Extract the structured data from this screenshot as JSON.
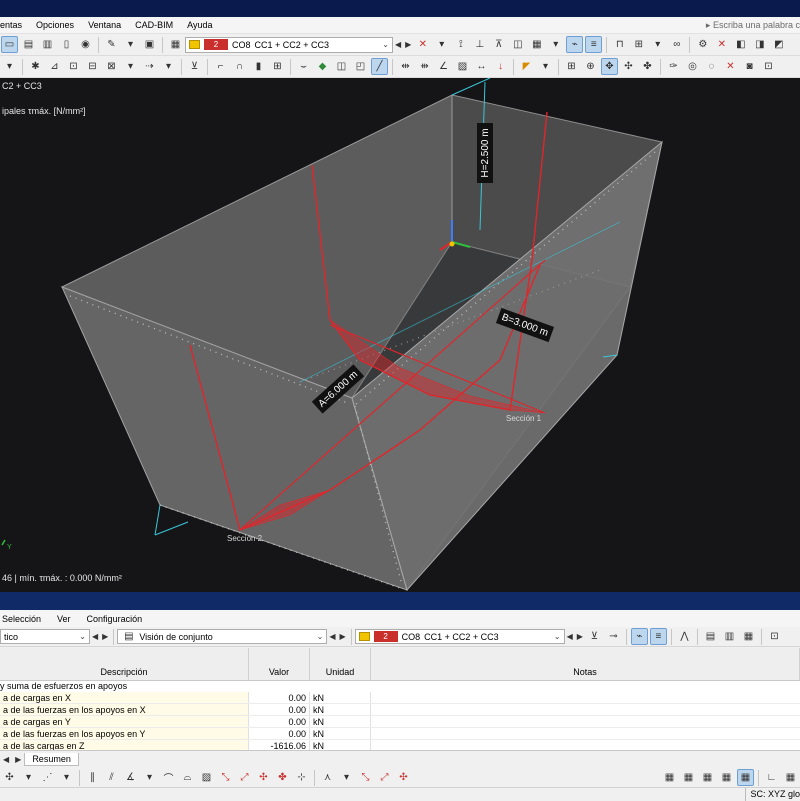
{
  "menu": [
    "entas",
    "Opciones",
    "Ventana",
    "CAD-BIM",
    "Ayuda"
  ],
  "search": {
    "placeholder": "Escriba una palabra c"
  },
  "toolbar": {
    "lc_number": "2",
    "lc_name": "CO8",
    "lc_description": "CC1 + CC2 + CC3",
    "swatch_color": "#f2c400",
    "number_color": "#c9302c"
  },
  "viewport": {
    "top_label": "C2 + CC3",
    "result_label": "ipales τmáx. [N/mm²]",
    "bottom_label": "46 | mín. τmáx. : 0.000 N/mm²",
    "dimensions": {
      "h": "H=2.500 m",
      "b": "B=3.000 m",
      "a": "A=6.000 m"
    },
    "sections": [
      "Sección 1",
      "Sección 2"
    ],
    "axis_label": "Y"
  },
  "panel": {
    "menu": [
      "Selección",
      "Ver",
      "Configuración"
    ],
    "filter_combo": "tico",
    "view_combo": "Visión de conjunto",
    "lc_number": "2",
    "lc_name": "CO8",
    "lc_description": "CC1 + CC2 + CC3"
  },
  "table": {
    "headers": {
      "description": "Descripción",
      "value": "Valor",
      "unit": "Unidad",
      "notes": "Notas"
    },
    "section_title": "y suma de esfuerzos en apoyos",
    "rows": [
      {
        "description": "a de cargas en X",
        "value": "0.00",
        "unit": "kN"
      },
      {
        "description": "a de las fuerzas en los apoyos en X",
        "value": "0.00",
        "unit": "kN"
      },
      {
        "description": "a de cargas en Y",
        "value": "0.00",
        "unit": "kN"
      },
      {
        "description": "a de las fuerzas en los apoyos en Y",
        "value": "0.00",
        "unit": "kN"
      },
      {
        "description": "a de las cargas en Z",
        "value": "-1616.06",
        "unit": "kN"
      }
    ]
  },
  "tabs": [
    "Resumen"
  ],
  "status": {
    "coord_system": "SC: XYZ glo"
  }
}
